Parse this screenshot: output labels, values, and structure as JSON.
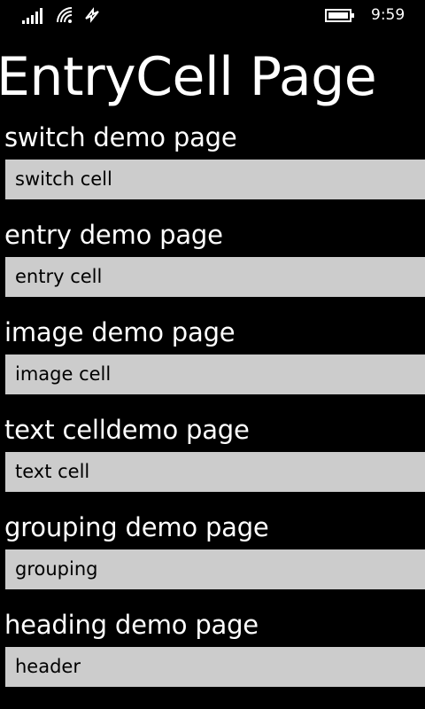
{
  "status_bar": {
    "time": "9:59",
    "icons": [
      "signal-strength-icon",
      "wifi-icon",
      "data-sync-icon",
      "battery-icon"
    ]
  },
  "page": {
    "title": "EntryCell Page"
  },
  "sections": [
    {
      "heading": "switch demo page",
      "cell_label": "switch cell"
    },
    {
      "heading": "entry demo page",
      "cell_label": "entry cell"
    },
    {
      "heading": "image demo page",
      "cell_label": "image cell"
    },
    {
      "heading": "text celldemo page",
      "cell_label": "text cell"
    },
    {
      "heading": "grouping demo page",
      "cell_label": "grouping"
    },
    {
      "heading": "heading demo page",
      "cell_label": "header"
    }
  ],
  "colors": {
    "background": "#000000",
    "text": "#ffffff",
    "cell_background": "#cccccc",
    "cell_text": "#000000"
  }
}
